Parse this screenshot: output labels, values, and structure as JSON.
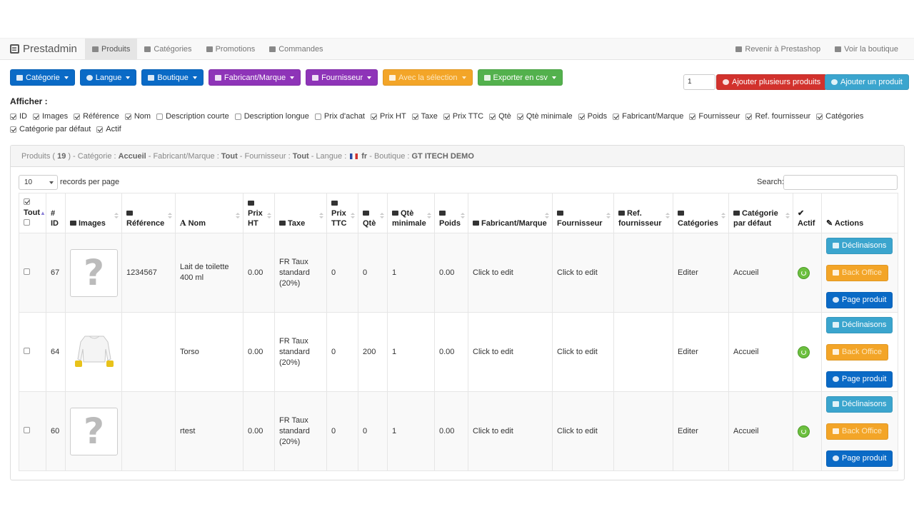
{
  "navbar": {
    "brand": "Prestadmin",
    "tabs": [
      {
        "label": "Produits",
        "icon": "book-icon"
      },
      {
        "label": "Catégories",
        "icon": "folder-icon"
      },
      {
        "label": "Promotions",
        "icon": "tag-icon"
      },
      {
        "label": "Commandes",
        "icon": "credit-card-icon"
      }
    ],
    "right_links": [
      {
        "label": "Revenir à Prestashop",
        "icon": "back-arrow-icon"
      },
      {
        "label": "Voir la boutique",
        "icon": "home-icon"
      }
    ]
  },
  "toolbar": {
    "filters": [
      {
        "label": "Catégorie",
        "color": "#0a6ac6"
      },
      {
        "label": "Langue",
        "color": "#0a6ac6"
      },
      {
        "label": "Boutique",
        "color": "#0a6ac6"
      },
      {
        "label": "Fabricant/Marque",
        "color": "#8e34b8"
      },
      {
        "label": "Fournisseur",
        "color": "#8e34b8"
      },
      {
        "label": "Avec la sélection",
        "color": "#f3a528"
      },
      {
        "label": "Exporter en csv",
        "color": "#53b14d"
      }
    ],
    "quantity_value": "1",
    "add_many_label": "Ajouter plusieurs produits",
    "add_one_label": "Ajouter un produit"
  },
  "columns_toggle": {
    "title": "Afficher :",
    "options": [
      {
        "label": "ID",
        "checked": true
      },
      {
        "label": "Images",
        "checked": true
      },
      {
        "label": "Référence",
        "checked": true
      },
      {
        "label": "Nom",
        "checked": true
      },
      {
        "label": "Description courte",
        "checked": false
      },
      {
        "label": "Description longue",
        "checked": false
      },
      {
        "label": "Prix d'achat",
        "checked": false
      },
      {
        "label": "Prix HT",
        "checked": true
      },
      {
        "label": "Taxe",
        "checked": true
      },
      {
        "label": "Prix TTC",
        "checked": true
      },
      {
        "label": "Qtè",
        "checked": true
      },
      {
        "label": "Qtè minimale",
        "checked": true
      },
      {
        "label": "Poids",
        "checked": true
      },
      {
        "label": "Fabricant/Marque",
        "checked": true
      },
      {
        "label": "Fournisseur",
        "checked": true
      },
      {
        "label": "Ref. fournisseur",
        "checked": true
      },
      {
        "label": "Catégories",
        "checked": true
      },
      {
        "label": "Catégorie par défaut",
        "checked": true
      },
      {
        "label": "Actif",
        "checked": true
      }
    ]
  },
  "panel": {
    "products_label": "Produits (",
    "products_count": "19",
    "sep1": ") - Catégorie : ",
    "categorie": "Accueil",
    "sep2": " - Fabricant/Marque : ",
    "fabricant": "Tout",
    "sep3": " - Fournisseur : ",
    "fournisseur": "Tout",
    "sep4": " - Langue : ",
    "langue": "fr",
    "sep5": " - Boutique : ",
    "boutique": "GT ITECH DEMO"
  },
  "table_controls": {
    "page_length": "10",
    "page_length_label": "records per page",
    "search_label": "Search:"
  },
  "table": {
    "headers": {
      "tout": "Tout",
      "id": "ID",
      "images": "Images",
      "reference": "Référence",
      "nom": "Nom",
      "prix_ht": "Prix HT",
      "taxe": "Taxe",
      "prix_ttc": "Prix TTC",
      "qte": "Qtè",
      "qte_min": "Qtè minimale",
      "poids": "Poids",
      "fabricant": "Fabricant/Marque",
      "fournisseur": "Fournisseur",
      "ref_fournisseur": "Ref. fournisseur",
      "categories": "Catégories",
      "cat_defaut": "Catégorie par défaut",
      "actif": "Actif",
      "actions": "Actions"
    },
    "rows": [
      {
        "id": "67",
        "image": "placeholder",
        "reference": "1234567",
        "nom": "Lait de toilette 400 ml",
        "prix_ht": "0.00",
        "taxe": "FR Taux standard (20%)",
        "prix_ttc": "0",
        "qte": "0",
        "qte_min": "1",
        "poids": "0.00",
        "fabricant": "Click to edit",
        "fournisseur": "Click to edit",
        "ref_fournisseur": "",
        "categories": "Editer",
        "cat_defaut": "Accueil"
      },
      {
        "id": "64",
        "image": "torso",
        "reference": "",
        "nom": "Torso",
        "prix_ht": "0.00",
        "taxe": "FR Taux standard (20%)",
        "prix_ttc": "0",
        "qte": "200",
        "qte_min": "1",
        "poids": "0.00",
        "fabricant": "Click to edit",
        "fournisseur": "Click to edit",
        "ref_fournisseur": "",
        "categories": "Editer",
        "cat_defaut": "Accueil"
      },
      {
        "id": "60",
        "image": "placeholder",
        "reference": "",
        "nom": "rtest",
        "prix_ht": "0.00",
        "taxe": "FR Taux standard (20%)",
        "prix_ttc": "0",
        "qte": "0",
        "qte_min": "1",
        "poids": "0.00",
        "fabricant": "Click to edit",
        "fournisseur": "Click to edit",
        "ref_fournisseur": "",
        "categories": "Editer",
        "cat_defaut": "Accueil"
      }
    ],
    "actions": {
      "declinaisons": "Déclinaisons",
      "back_office": "Back Office",
      "page_produit": "Page produit"
    },
    "placeholder_glyph": "?"
  }
}
